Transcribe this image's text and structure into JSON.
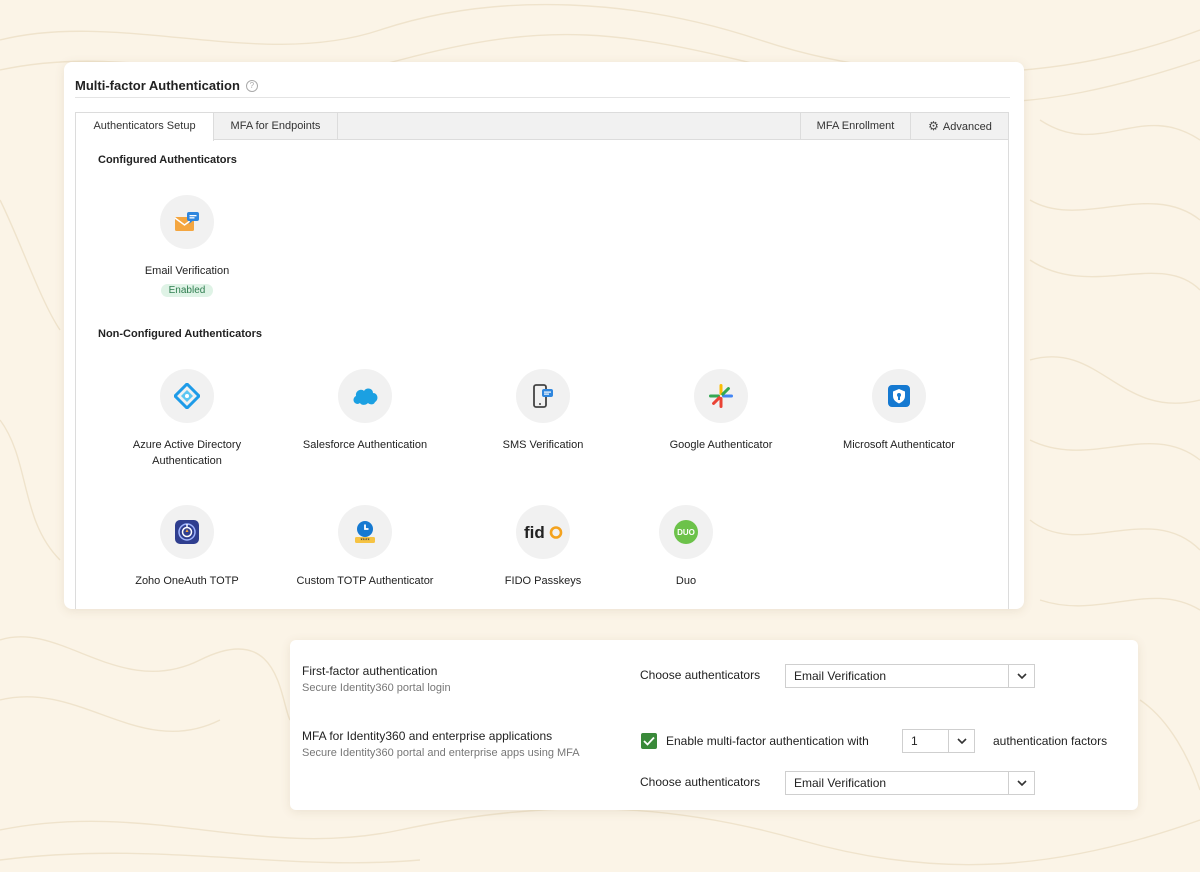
{
  "page": {
    "title": "Multi-factor Authentication",
    "tabs": {
      "setup": "Authenticators Setup",
      "endpoints": "MFA for Endpoints",
      "enrollment": "MFA Enrollment",
      "advanced": "Advanced"
    },
    "configured": {
      "heading": "Configured Authenticators",
      "items": [
        {
          "name": "Email Verification",
          "status": "Enabled",
          "icon": "email-icon"
        }
      ]
    },
    "non_configured": {
      "heading": "Non-Configured Authenticators",
      "items": [
        {
          "name": "Azure Active Directory Authentication",
          "icon": "azure-icon"
        },
        {
          "name": "Salesforce Authentication",
          "icon": "salesforce-icon"
        },
        {
          "name": "SMS Verification",
          "icon": "sms-icon"
        },
        {
          "name": "Google Authenticator",
          "icon": "google-authenticator-icon"
        },
        {
          "name": "Microsoft Authenticator",
          "icon": "microsoft-authenticator-icon"
        },
        {
          "name": "Zoho OneAuth TOTP",
          "icon": "oneauth-icon"
        },
        {
          "name": "Custom TOTP Authenticator",
          "icon": "custom-totp-icon"
        },
        {
          "name": "FIDO Passkeys",
          "icon": "fido-icon"
        },
        {
          "name": "Duo",
          "icon": "duo-icon"
        }
      ]
    }
  },
  "settings": {
    "first_factor": {
      "title": "First-factor authentication",
      "subtitle": "Secure Identity360 portal login",
      "choose_label": "Choose authenticators",
      "selected": "Email Verification"
    },
    "mfa": {
      "title": "MFA for Identity360 and enterprise applications",
      "subtitle": "Secure Identity360 portal and enterprise apps using MFA",
      "enable_label": "Enable multi-factor authentication with",
      "enabled": true,
      "factor_count": "1",
      "factors_suffix": "authentication factors",
      "choose_label": "Choose authenticators",
      "selected": "Email Verification"
    }
  },
  "colors": {
    "background": "#fbf4e7",
    "enabled_badge_bg": "#dff3e6",
    "enabled_badge_text": "#2e7d4f",
    "checkbox": "#3a8a3a"
  }
}
